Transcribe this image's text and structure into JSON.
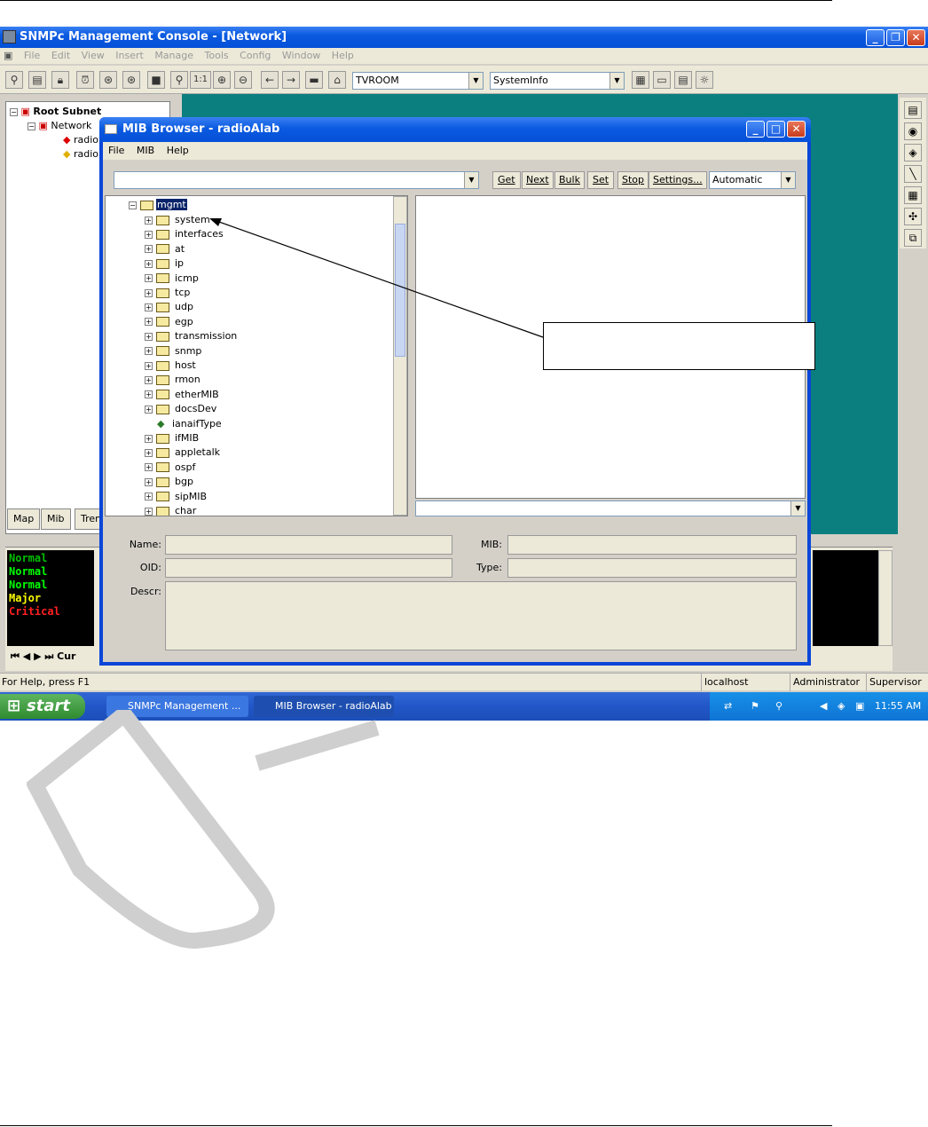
{
  "main_window": {
    "title": "SNMPc Management Console - [Network]",
    "menu": [
      "File",
      "Edit",
      "View",
      "Insert",
      "Manage",
      "Tools",
      "Config",
      "Window",
      "Help"
    ],
    "toolbar": {
      "device_combo": "TVROOM",
      "info_combo": "SystemInfo",
      "zoom_label": "1:1"
    }
  },
  "left_tree": {
    "items": [
      "Root Subnet",
      "Network",
      "radio",
      "radio"
    ],
    "tabs": [
      "Map",
      "Mib",
      "Tren"
    ]
  },
  "events": {
    "items": [
      {
        "text": "Normal",
        "color": "#00c000"
      },
      {
        "text": "Normal",
        "color": "#00ff00"
      },
      {
        "text": "Normal",
        "color": "#00ff00"
      },
      {
        "text": "Major",
        "color": "#ffff00"
      },
      {
        "text": "Critical",
        "color": "#ff2020"
      }
    ],
    "tab": "Cur"
  },
  "statusbar": {
    "help": "For Help, press F1",
    "host": "localhost",
    "user": "Administrator",
    "role": "Supervisor"
  },
  "taskbar": {
    "start": "start",
    "tasks": [
      "SNMPc Management ...",
      "MIB Browser - radioAlab"
    ],
    "clock": "11:55 AM"
  },
  "mib_browser": {
    "title": "MIB Browser - radioAlab",
    "menu": [
      "File",
      "MIB",
      "Help"
    ],
    "buttons": [
      "Get",
      "Next",
      "Bulk",
      "Set",
      "Stop",
      "Settings..."
    ],
    "mode": "Automatic",
    "tree_root": "mgmt",
    "tree_items": [
      "system",
      "interfaces",
      "at",
      "ip",
      "icmp",
      "tcp",
      "udp",
      "egp",
      "transmission",
      "snmp",
      "host",
      "rmon",
      "etherMIB",
      "docsDev",
      "ianaifType",
      "ifMIB",
      "appletalk",
      "ospf",
      "bgp",
      "sipMIB",
      "char"
    ],
    "fields": {
      "name": "Name:",
      "oid": "OID:",
      "descr": "Descr:",
      "mib": "MIB:",
      "type": "Type:"
    }
  },
  "watermark": "DI"
}
